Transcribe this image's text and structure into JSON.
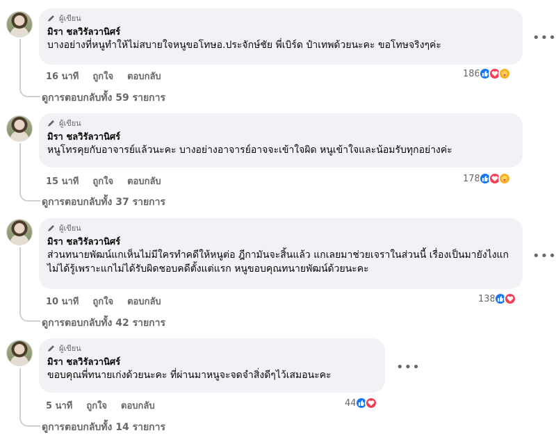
{
  "comments": [
    {
      "author_tag": "ผู้เขียน",
      "name": "มิรา ชลวิรัลวานิศร์",
      "text": "บางอย่างที่หนูทำให้ไม่สบายใจหนูขอโทษอ.ประจักษ์ชัย พี่เบิร์ด ป๋าเทพด้วยนะคะ ขอโทษจริงๆค่ะ",
      "time": "16 นาที",
      "like_label": "ถูกใจ",
      "reply_label": "ตอบกลับ",
      "reaction_count": "186",
      "reactions": [
        "like-icon",
        "love-icon",
        "care-icon"
      ],
      "replies_link": "ดูการตอบกลับทั้ง 59 รายการ"
    },
    {
      "author_tag": "ผู้เขียน",
      "name": "มิรา ชลวิรัลวานิศร์",
      "text": "หนูโทรคุยกับอาจารย์แล้วนะคะ บางอย่างอาจารย์อาจจะเข้าใจผิด หนูเข้าใจและน้อมรับทุกอย่างค่ะ",
      "time": "15 นาที",
      "like_label": "ถูกใจ",
      "reply_label": "ตอบกลับ",
      "reaction_count": "178",
      "reactions": [
        "like-icon",
        "love-icon",
        "care-icon"
      ],
      "replies_link": "ดูการตอบกลับทั้ง 37 รายการ"
    },
    {
      "author_tag": "ผู้เขียน",
      "name": "มิรา ชลวิรัลวานิศร์",
      "text": "ส่วนทนายพัฒน์แกเห็นไม่มีใครทำคดีให้หนูต่อ ฎีกามันจะสิ้นแล้ว แกเลยมาช่วยเจราในส่วนนี้ เรื่องเป็นมายังไงแกไม่ได้รู้เพราะแกไม่ได้รับผิดชอบคดีตั้งแต่แรก หนูขอบคุณทนายพัฒน์ด้วยนะคะ",
      "time": "10 นาที",
      "like_label": "ถูกใจ",
      "reply_label": "ตอบกลับ",
      "reaction_count": "138",
      "reactions": [
        "like-icon",
        "love-icon"
      ],
      "replies_link": "ดูการตอบกลับทั้ง 42 รายการ"
    },
    {
      "author_tag": "ผู้เขียน",
      "name": "มิรา ชลวิรัลวานิศร์",
      "text": "ขอบคุณพี่ทนายเก่งด้วยนะคะ ที่ผ่านมาหนูจะจดจำสิ่งดีๆไว้เสมอนะคะ",
      "time": "5 นาที",
      "like_label": "ถูกใจ",
      "reply_label": "ตอบกลับ",
      "reaction_count": "44",
      "reactions": [
        "like-icon",
        "love-icon"
      ],
      "replies_link": "ดูการตอบกลับทั้ง 14 รายการ"
    }
  ],
  "more_icon": "more-options-icon",
  "colors": {
    "like": "#1877f2",
    "love": "#f33e58",
    "care": "#f7b125",
    "bubble": "#f0f2f5",
    "meta": "#65676b"
  }
}
